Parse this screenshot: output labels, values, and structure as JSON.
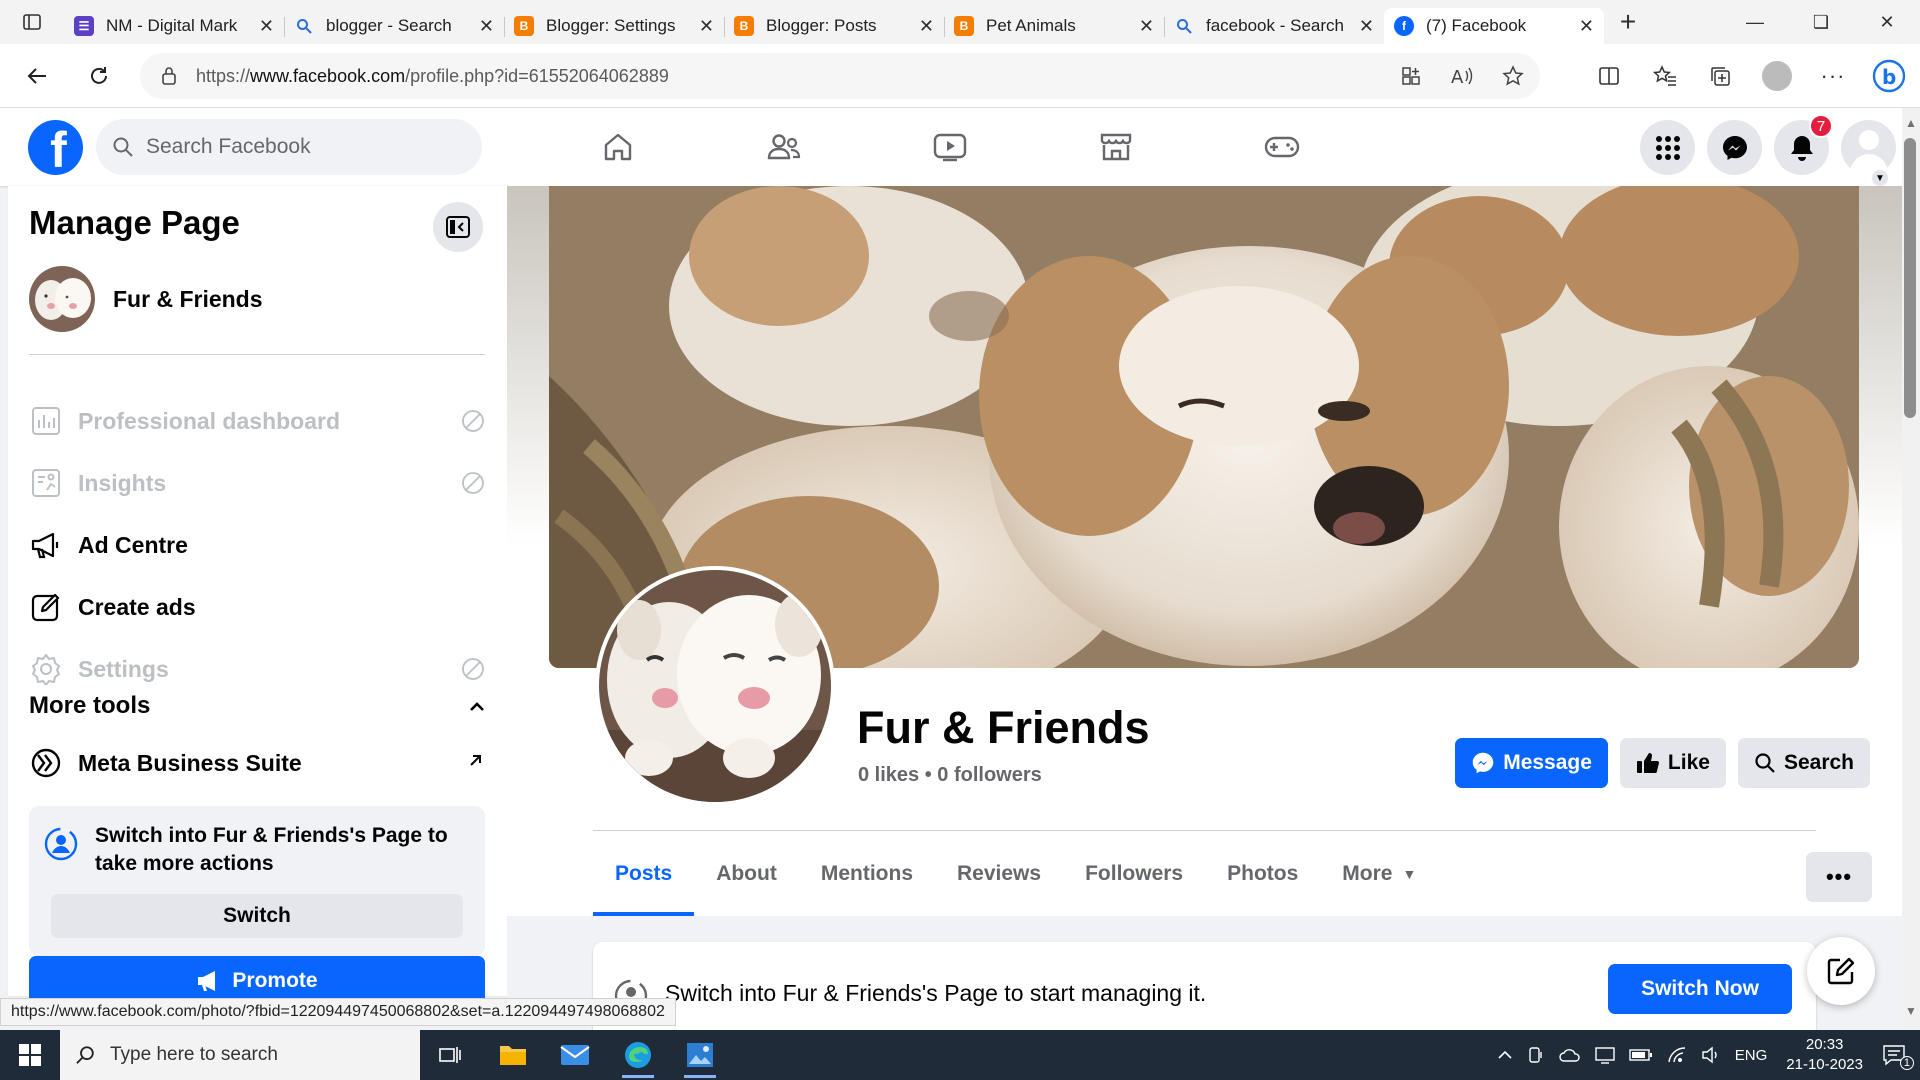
{
  "browser": {
    "tabs": [
      {
        "title": "NM - Digital Mark",
        "favicon_color": "#5b3fc4",
        "favicon_glyph": "form-icon",
        "active": false
      },
      {
        "title": "blogger - Search",
        "favicon_color": "#2b6fd6",
        "favicon_glyph": "search-icon",
        "active": false
      },
      {
        "title": "Blogger: Settings",
        "favicon_color": "#f57d00",
        "favicon_glyph": "blogger-icon",
        "active": false
      },
      {
        "title": "Blogger: Posts",
        "favicon_color": "#f57d00",
        "favicon_glyph": "blogger-icon",
        "active": false
      },
      {
        "title": "Pet Animals",
        "favicon_color": "#f57d00",
        "favicon_glyph": "blogger-icon",
        "active": false
      },
      {
        "title": "facebook - Search",
        "favicon_color": "#2b6fd6",
        "favicon_glyph": "search-icon",
        "active": false
      },
      {
        "title": "(7) Facebook",
        "favicon_color": "#0866ff",
        "favicon_glyph": "facebook-icon",
        "active": true
      }
    ],
    "url_prefix": "https://",
    "url_host": "www.facebook.com",
    "url_path": "/profile.php?id=61552064062889"
  },
  "fb_header": {
    "search_placeholder": "Search Facebook",
    "notification_count": "7",
    "nav": [
      "home-icon",
      "friends-icon",
      "video-icon",
      "marketplace-icon",
      "gaming-icon"
    ]
  },
  "left_panel": {
    "title": "Manage Page",
    "page_name": "Fur & Friends",
    "menu": [
      {
        "label": "Professional dashboard",
        "icon": "dashboard-icon",
        "disabled": true
      },
      {
        "label": "Insights",
        "icon": "insights-icon",
        "disabled": true
      },
      {
        "label": "Ad Centre",
        "icon": "megaphone-icon",
        "disabled": false
      },
      {
        "label": "Create ads",
        "icon": "edit-icon",
        "disabled": false
      },
      {
        "label": "Settings",
        "icon": "settings-icon",
        "disabled": true
      }
    ],
    "more_tools_label": "More tools",
    "meta_business_suite": "Meta Business Suite",
    "switch_card_text": "Switch into Fur & Friends's Page to take more actions",
    "switch_button": "Switch",
    "promote_button": "Promote"
  },
  "profile": {
    "name": "Fur & Friends",
    "stats": "0 likes • 0 followers",
    "actions": {
      "message": "Message",
      "like": "Like",
      "search": "Search"
    },
    "tabs": [
      "Posts",
      "About",
      "Mentions",
      "Reviews",
      "Followers",
      "Photos",
      "More"
    ],
    "active_tab": "Posts",
    "more_dots": "•••"
  },
  "switch_banner": {
    "text": "Switch into Fur & Friends's Page to start managing it.",
    "button": "Switch Now"
  },
  "status_url": "https://www.facebook.com/photo/?fbid=122094497450068802&set=a.122094497498068802",
  "taskbar": {
    "search_placeholder": "Type here to search",
    "language": "ENG",
    "time": "20:33",
    "date": "21-10-2023",
    "notification_count": "1"
  }
}
